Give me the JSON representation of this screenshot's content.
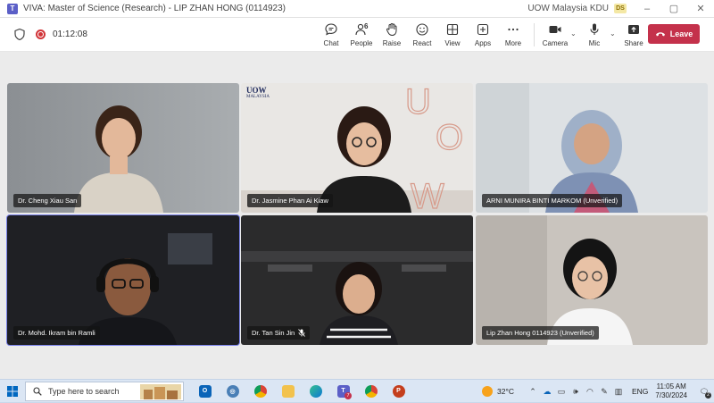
{
  "window": {
    "title": "VIVA: Master of Science (Research) - LIP ZHAN HONG (0114923)",
    "org": "UOW Malaysia KDU",
    "avatar_initials": "DS",
    "controls": [
      "–",
      "▢",
      "✕"
    ]
  },
  "toolbar": {
    "timer": "01:12:08",
    "people_count": "6",
    "buttons": [
      {
        "label": "Chat",
        "icon": "chat-icon"
      },
      {
        "label": "People",
        "icon": "people-icon"
      },
      {
        "label": "Raise",
        "icon": "hand-icon"
      },
      {
        "label": "React",
        "icon": "smile-icon"
      },
      {
        "label": "View",
        "icon": "grid-icon"
      },
      {
        "label": "Apps",
        "icon": "plus-square-icon"
      },
      {
        "label": "More",
        "icon": "more-icon"
      }
    ],
    "camera_label": "Camera",
    "mic_label": "Mic",
    "share_label": "Share",
    "leave_label": "Leave",
    "leave_color": "#c4314b"
  },
  "participants": [
    {
      "name": "Dr. Cheng Xiau San",
      "muted": false
    },
    {
      "name": "Dr. Jasmine Phan Ai Kiaw",
      "muted": false
    },
    {
      "name": "ARNI MUNIRA BINTI MARKOM (Unverified)",
      "muted": false
    },
    {
      "name": "Dr. Mohd. Ikram bin Ramli",
      "muted": false,
      "active_speaker": true
    },
    {
      "name": "Dr. Tan Sin Jin",
      "muted": true
    },
    {
      "name": "Lip Zhan Hong 0114923 (Unverified)",
      "muted": false
    }
  ],
  "background_branding": {
    "uow_big": "UOW",
    "uow_small": "MALAYSIA",
    "letters": [
      "U",
      "O",
      "W"
    ]
  },
  "taskbar": {
    "search_placeholder": "Type here to search",
    "teams_badge": "7",
    "temperature": "32°C",
    "language": "ENG",
    "time": "11:05 AM",
    "date": "7/30/2024",
    "notification_count": "2"
  }
}
